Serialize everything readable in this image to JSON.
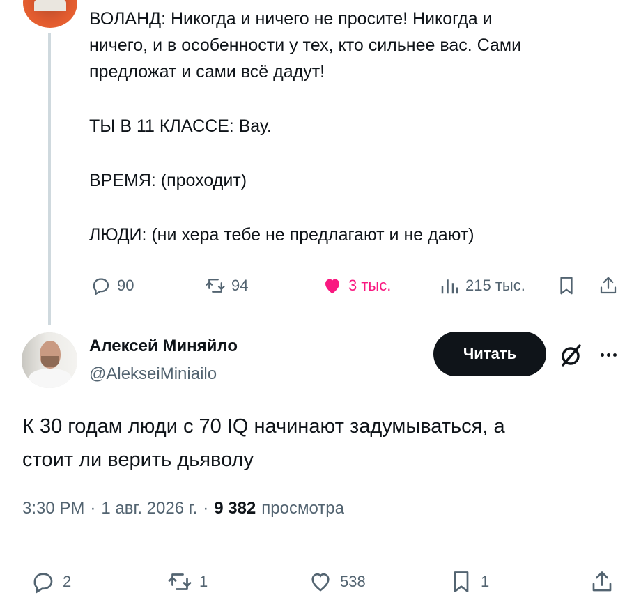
{
  "parent_tweet": {
    "lines": [
      "ВОЛАНД: Никогда и ничего не просите! Никогда и",
      "ничего, и в особенности у тех, кто сильнее вас. Сами",
      "предложат и сами всё дадут!",
      "ТЫ В 11 КЛАССЕ: Вау.",
      "ВРЕМЯ: (проходит)",
      "ЛЮДИ: (ни хера тебе не предлагают и не дают)"
    ],
    "actions": {
      "replies": "90",
      "reposts": "94",
      "likes": "3 тыс.",
      "views": "215 тыс."
    }
  },
  "main_tweet": {
    "author_name": "Алексей Миняйло",
    "author_handle": "@AlekseiMiniailo",
    "follow_label": "Читать",
    "text_line1": "К 30 годам люди с 70 IQ начинают задумываться, а",
    "text_line2": "стоит ли верить дьяволу",
    "time": "3:30 PM",
    "date": "1 авг. 2026 г.",
    "separator": "·",
    "views_count": "9 382",
    "views_label": "просмотра",
    "actions": {
      "replies": "2",
      "reposts": "1",
      "likes": "538",
      "bookmarks": "1"
    }
  },
  "colors": {
    "text": "#0f1419",
    "secondary": "#536471",
    "like_pink": "#f91880",
    "thread_line": "#cfd9de"
  }
}
